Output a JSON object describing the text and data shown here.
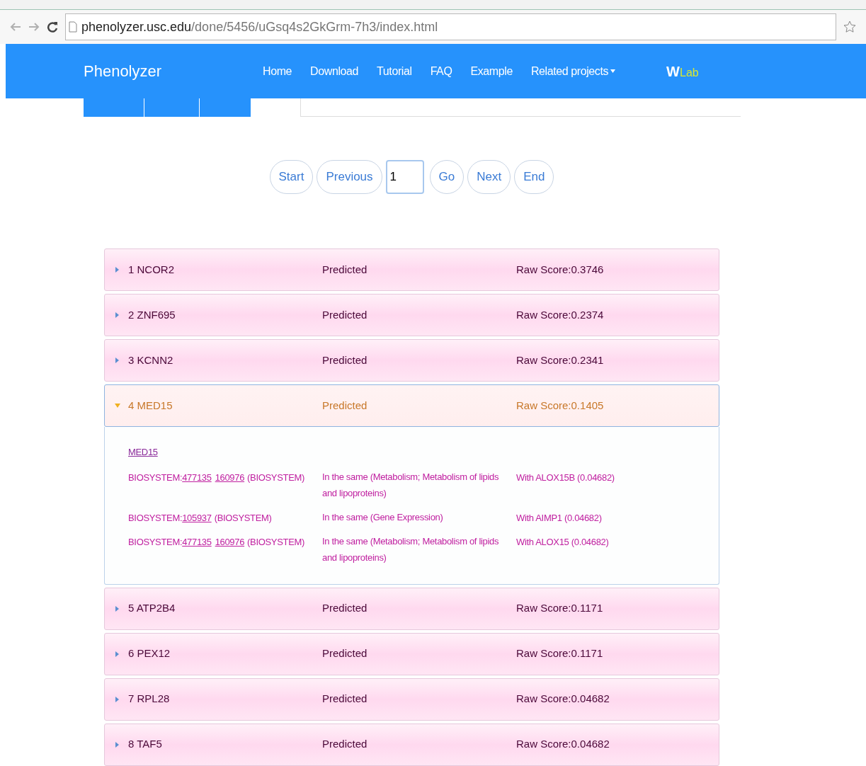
{
  "browser": {
    "url_host": "phenolyzer.usc.edu",
    "url_path": "/done/5456/uGsq4s2GkGrm-7h3/index.html"
  },
  "navbar": {
    "brand": "Phenolyzer",
    "links": [
      {
        "label": "Home",
        "dropdown": false
      },
      {
        "label": "Download",
        "dropdown": false
      },
      {
        "label": "Tutorial",
        "dropdown": false
      },
      {
        "label": "FAQ",
        "dropdown": false
      },
      {
        "label": "Example",
        "dropdown": false
      },
      {
        "label": "Related projects",
        "dropdown": true
      }
    ],
    "logo": {
      "first": "W",
      "rest": "Lab"
    }
  },
  "pagination": {
    "buttons_before": [
      "Start",
      "Previous"
    ],
    "page_value": "1",
    "buttons_after": [
      "Go",
      "Next",
      "End"
    ]
  },
  "genes": [
    {
      "label": "1 NCOR2",
      "status": "Predicted",
      "score": "Raw Score:0.3746",
      "expanded": false
    },
    {
      "label": "2 ZNF695",
      "status": "Predicted",
      "score": "Raw Score:0.2374",
      "expanded": false
    },
    {
      "label": "3 KCNN2",
      "status": "Predicted",
      "score": "Raw Score:0.2341",
      "expanded": false
    },
    {
      "label": "4 MED15",
      "status": "Predicted",
      "score": "Raw Score:0.1405",
      "expanded": true,
      "detail": {
        "gene_link": "MED15",
        "rows": [
          {
            "prefix": "BIOSYSTEM:",
            "links": [
              "477135",
              "160976"
            ],
            "suffix": "(BIOSYSTEM)",
            "relation": "In the same (Metabolism; Metabolism of lipids and lipoproteins)",
            "with": "With ALOX15B (0.04682)"
          },
          {
            "prefix": "BIOSYSTEM:",
            "links": [
              "105937"
            ],
            "suffix": "(BIOSYSTEM)",
            "relation": "In the same (Gene Expression)",
            "with": "With AIMP1 (0.04682)"
          },
          {
            "prefix": "BIOSYSTEM:",
            "links": [
              "477135",
              "160976"
            ],
            "suffix": "(BIOSYSTEM)",
            "relation": "In the same (Metabolism; Metabolism of lipids and lipoproteins)",
            "with": "With ALOX15 (0.04682)"
          }
        ]
      }
    },
    {
      "label": "5 ATP2B4",
      "status": "Predicted",
      "score": "Raw Score:0.1171",
      "expanded": false
    },
    {
      "label": "6 PEX12",
      "status": "Predicted",
      "score": "Raw Score:0.1171",
      "expanded": false
    },
    {
      "label": "7 RPL28",
      "status": "Predicted",
      "score": "Raw Score:0.04682",
      "expanded": false
    },
    {
      "label": "8 TAF5",
      "status": "Predicted",
      "score": "Raw Score:0.04682",
      "expanded": false
    }
  ]
}
